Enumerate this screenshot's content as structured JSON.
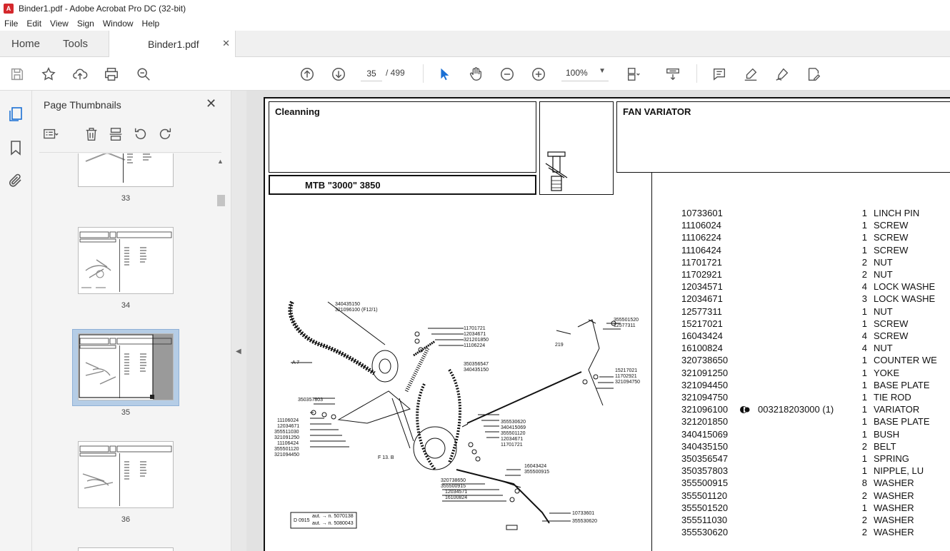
{
  "window": {
    "title": "Binder1.pdf - Adobe Acrobat Pro DC (32-bit)"
  },
  "menu": [
    "File",
    "Edit",
    "View",
    "Sign",
    "Window",
    "Help"
  ],
  "tabs": {
    "home": "Home",
    "tools": "Tools",
    "document": "Binder1.pdf"
  },
  "toolbar": {
    "page_current": "35",
    "page_total": "/  499",
    "zoom": "100%"
  },
  "thumbnails": {
    "title": "Page Thumbnails",
    "pages": [
      "33",
      "34",
      "35",
      "36"
    ]
  },
  "document": {
    "section": "Cleanning",
    "model": "MTB \"3000\" 3850",
    "group": "FAN VARIATOR",
    "parts": [
      {
        "code": "10733601",
        "qty": "1",
        "desc": "LINCH PIN"
      },
      {
        "code": "11106024",
        "qty": "1",
        "desc": "SCREW"
      },
      {
        "code": "11106224",
        "qty": "1",
        "desc": "SCREW"
      },
      {
        "code": "11106424",
        "qty": "1",
        "desc": "SCREW"
      },
      {
        "code": "11701721",
        "qty": "2",
        "desc": "NUT"
      },
      {
        "code": "11702921",
        "qty": "2",
        "desc": "NUT"
      },
      {
        "code": "12034571",
        "qty": "4",
        "desc": "LOCK WASHE"
      },
      {
        "code": "12034671",
        "qty": "3",
        "desc": "LOCK WASHE"
      },
      {
        "code": "12577311",
        "qty": "1",
        "desc": "NUT"
      },
      {
        "code": "15217021",
        "qty": "1",
        "desc": "SCREW"
      },
      {
        "code": "16043424",
        "qty": "4",
        "desc": "SCREW"
      },
      {
        "code": "16100824",
        "qty": "4",
        "desc": "NUT"
      },
      {
        "code": "320738650",
        "qty": "1",
        "desc": "COUNTER WE"
      },
      {
        "code": "321091250",
        "qty": "1",
        "desc": "YOKE"
      },
      {
        "code": "321094450",
        "qty": "1",
        "desc": "BASE PLATE"
      },
      {
        "code": "321094750",
        "qty": "1",
        "desc": "TIE ROD"
      },
      {
        "code": "321096100",
        "qty": "1",
        "desc": "VARIATOR",
        "note": "003218203000  (1)"
      },
      {
        "code": "321201850",
        "qty": "1",
        "desc": "BASE PLATE"
      },
      {
        "code": "340415069",
        "qty": "1",
        "desc": "BUSH"
      },
      {
        "code": "340435150",
        "qty": "2",
        "desc": "BELT"
      },
      {
        "code": "350356547",
        "qty": "1",
        "desc": "SPRING"
      },
      {
        "code": "350357803",
        "qty": "1",
        "desc": "NIPPLE, LU"
      },
      {
        "code": "355500915",
        "qty": "8",
        "desc": "WASHER"
      },
      {
        "code": "355501120",
        "qty": "2",
        "desc": "WASHER"
      },
      {
        "code": "355501520",
        "qty": "1",
        "desc": "WASHER"
      },
      {
        "code": "355511030",
        "qty": "2",
        "desc": "WASHER"
      },
      {
        "code": "355530620",
        "qty": "2",
        "desc": "WASHER"
      }
    ],
    "diagram_labels": {
      "a7": "A 7",
      "f12": "321096100 (F12/1)",
      "belt": "340435150",
      "f13": "F 13. B",
      "n219": "219",
      "d0915": "D 0915",
      "aut1": "aut. → n. 5070138",
      "aut2": "aut. → n. 5080043",
      "group1": [
        "11701721",
        "12034671",
        "321201850",
        "11106224"
      ],
      "group2": [
        "350356547",
        "340435150"
      ],
      "n350357803": "350357803",
      "group3": [
        "11106024",
        "12034671",
        "355511030",
        "321091250",
        "11106424",
        "355501120",
        "321094450"
      ],
      "group4": [
        "355530620",
        "340415069",
        "355501120",
        "12034671",
        "11701721"
      ],
      "group5": [
        "355501520",
        "12577311"
      ],
      "group6": [
        "15217021",
        "11702921",
        "321094750"
      ],
      "group7": [
        "16043424",
        "355500915"
      ],
      "group8": [
        "320738650",
        "355500915",
        "12034571",
        "16100824"
      ],
      "group9": [
        "10733601",
        "355530620"
      ]
    }
  }
}
